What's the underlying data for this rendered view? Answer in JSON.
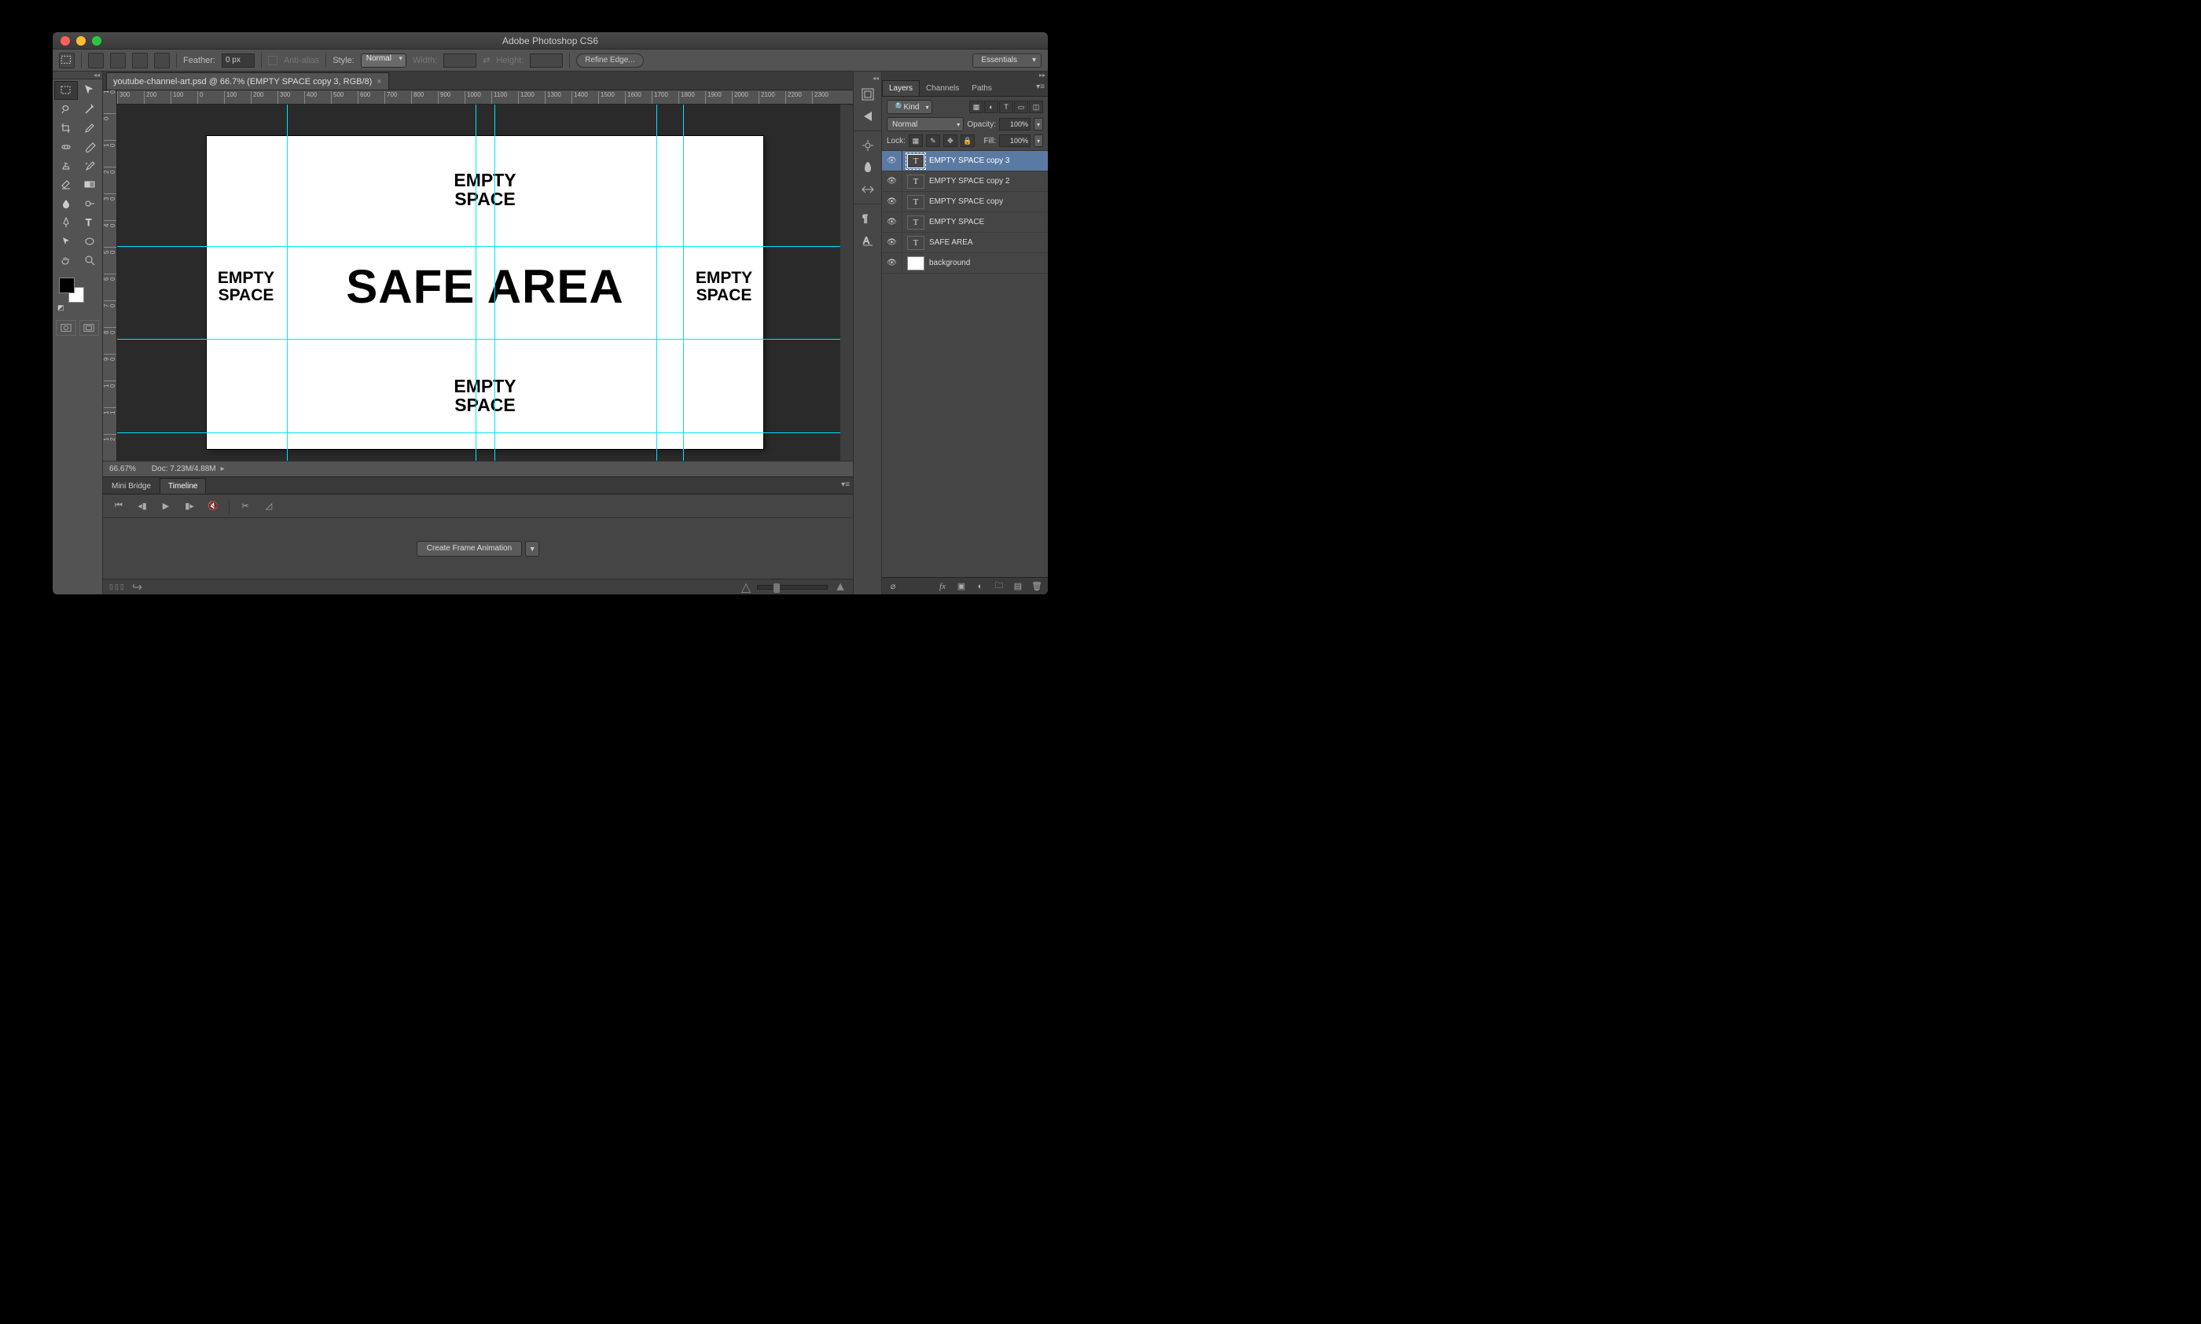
{
  "title": "Adobe Photoshop CS6",
  "optionsbar": {
    "feather_label": "Feather:",
    "feather_value": "0 px",
    "antialias_label": "Anti-alias",
    "style_label": "Style:",
    "style_value": "Normal",
    "width_label": "Width:",
    "height_label": "Height:",
    "refine_label": "Refine Edge...",
    "workspace": "Essentials"
  },
  "document": {
    "tab_label": "youtube-channel-art.psd @ 66.7% (EMPTY SPACE copy 3, RGB/8)"
  },
  "ruler": {
    "h": [
      "300",
      "200",
      "100",
      "0",
      "100",
      "200",
      "300",
      "400",
      "500",
      "600",
      "700",
      "800",
      "900",
      "1000",
      "1100",
      "1200",
      "1300",
      "1400",
      "1500",
      "1600",
      "1700",
      "1800",
      "1900",
      "2000",
      "2100",
      "2200",
      "2300"
    ],
    "v": [
      "100",
      "0",
      "100",
      "200",
      "300",
      "400",
      "500",
      "600",
      "700",
      "800",
      "900",
      "1000",
      "1100",
      "1200"
    ]
  },
  "canvas": {
    "texts": {
      "top": "EMPTY\nSPACE",
      "bottom": "EMPTY\nSPACE",
      "left": "EMPTY\nSPACE",
      "right": "EMPTY\nSPACE",
      "center": "SAFE AREA"
    }
  },
  "status": {
    "zoom": "66.67%",
    "doc": "Doc: 7.23M/4.88M"
  },
  "bottom": {
    "tab_minibridge": "Mini Bridge",
    "tab_timeline": "Timeline",
    "create_frame": "Create Frame Animation"
  },
  "layerspanel": {
    "tabs": {
      "layers": "Layers",
      "channels": "Channels",
      "paths": "Paths"
    },
    "filter_kind": "Kind",
    "blend_mode": "Normal",
    "opacity_label": "Opacity:",
    "opacity_value": "100%",
    "lock_label": "Lock:",
    "fill_label": "Fill:",
    "fill_value": "100%",
    "layers": [
      {
        "name": "EMPTY SPACE copy 3",
        "type": "T",
        "selected": true
      },
      {
        "name": "EMPTY SPACE copy 2",
        "type": "T",
        "selected": false
      },
      {
        "name": "EMPTY SPACE copy",
        "type": "T",
        "selected": false
      },
      {
        "name": "EMPTY SPACE",
        "type": "T",
        "selected": false
      },
      {
        "name": "SAFE AREA",
        "type": "T",
        "selected": false
      },
      {
        "name": "background",
        "type": "pixel",
        "selected": false
      }
    ]
  }
}
